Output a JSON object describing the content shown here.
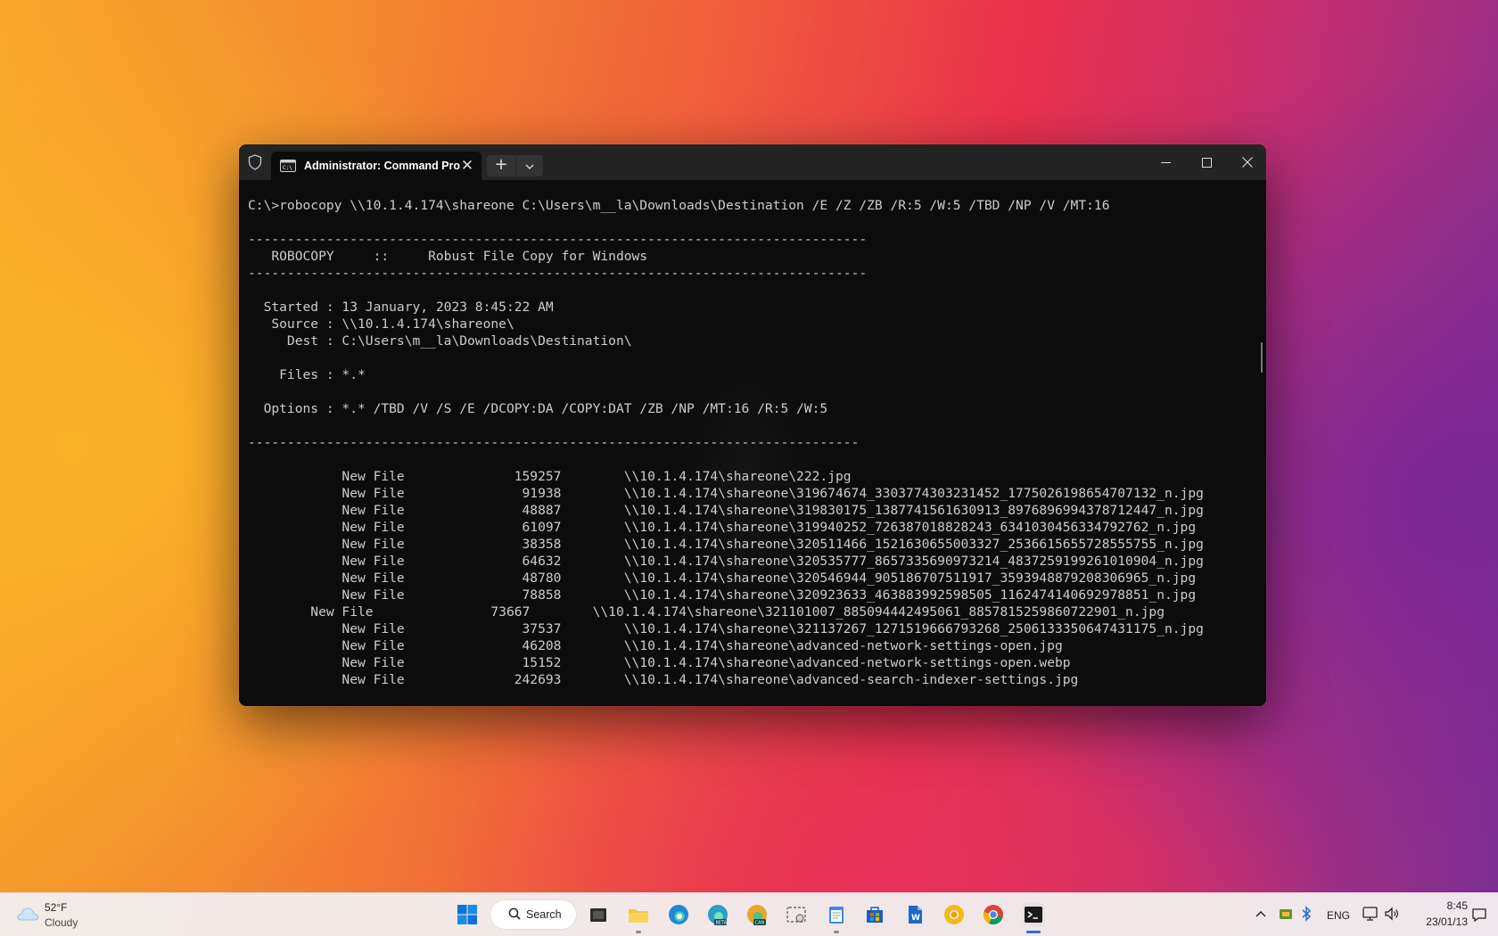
{
  "window": {
    "tab_title": "Administrator: Command Pro",
    "new_tab_glyph": "+",
    "close_tab_glyph": "✕"
  },
  "terminal": {
    "lines": [
      "",
      "C:\\>robocopy \\\\10.1.4.174\\shareone C:\\Users\\m__la\\Downloads\\Destination /E /Z /ZB /R:5 /W:5 /TBD /NP /V /MT:16",
      "",
      "-------------------------------------------------------------------------------",
      "   ROBOCOPY     ::     Robust File Copy for Windows",
      "-------------------------------------------------------------------------------",
      "",
      "  Started : 13 January, 2023 8:45:22 AM",
      "   Source : \\\\10.1.4.174\\shareone\\",
      "     Dest : C:\\Users\\m__la\\Downloads\\Destination\\",
      "",
      "    Files : *.*",
      "",
      "  Options : *.* /TBD /V /S /E /DCOPY:DA /COPY:DAT /ZB /NP /MT:16 /R:5 /W:5",
      "",
      "------------------------------------------------------------------------------",
      "",
      "            New File              159257        \\\\10.1.4.174\\shareone\\222.jpg",
      "            New File               91938        \\\\10.1.4.174\\shareone\\319674674_3303774303231452_1775026198654707132_n.jpg",
      "            New File               48887        \\\\10.1.4.174\\shareone\\319830175_1387741561630913_8976896994378712447_n.jpg",
      "            New File               61097        \\\\10.1.4.174\\shareone\\319940252_726387018828243_6341030456334792762_n.jpg",
      "            New File               38358        \\\\10.1.4.174\\shareone\\320511466_1521630655003327_2536615655728555755_n.jpg",
      "            New File               64632        \\\\10.1.4.174\\shareone\\320535777_8657335690973214_4837259199261010904_n.jpg",
      "            New File               48780        \\\\10.1.4.174\\shareone\\320546944_905186707511917_3593948879208306965_n.jpg",
      "            New File               78858        \\\\10.1.4.174\\shareone\\320923633_463883992598505_1162474140692978851_n.jpg",
      "        New File               73667        \\\\10.1.4.174\\shareone\\321101007_885094442495061_8857815259860722901_n.jpg",
      "            New File               37537        \\\\10.1.4.174\\shareone\\321137267_1271519666793268_2506133350647431175_n.jpg",
      "            New File               46208        \\\\10.1.4.174\\shareone\\advanced-network-settings-open.jpg",
      "            New File               15152        \\\\10.1.4.174\\shareone\\advanced-network-settings-open.webp",
      "            New File              242693        \\\\10.1.4.174\\shareone\\advanced-search-indexer-settings.jpg"
    ]
  },
  "taskbar": {
    "weather_temp": "52°F",
    "weather_condition": "Cloudy",
    "search_label": "Search",
    "language": "ENG",
    "time": "8:45",
    "date": "23/01/13"
  },
  "colors": {
    "terminal_bg": "#0c0c0c",
    "terminal_fg": "#cccccc",
    "titlebar_bg": "#242424"
  }
}
